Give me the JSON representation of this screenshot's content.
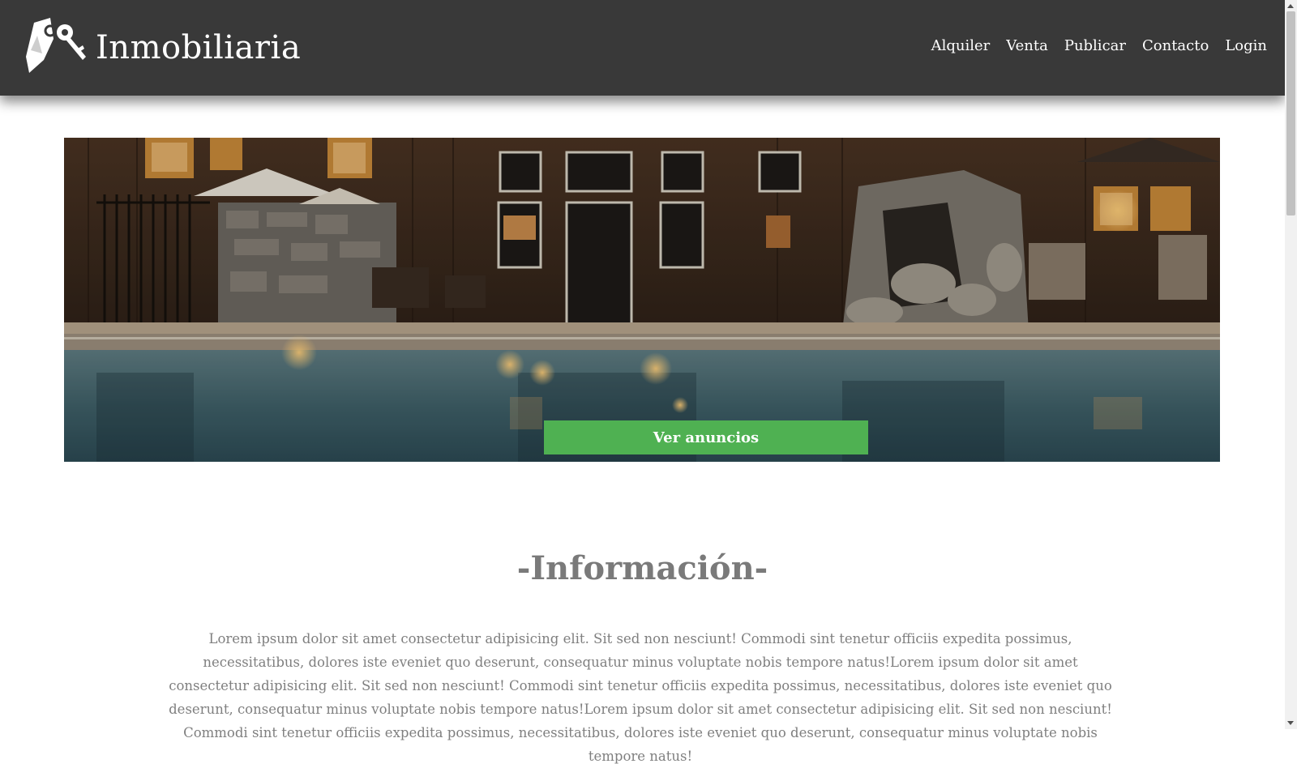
{
  "brand": {
    "name": "Inmobiliaria",
    "logo_icon": "house-keys-icon"
  },
  "nav": {
    "items": [
      {
        "label": "Alquiler"
      },
      {
        "label": "Venta"
      },
      {
        "label": "Publicar"
      },
      {
        "label": "Contacto"
      },
      {
        "label": "Login"
      }
    ]
  },
  "hero": {
    "image": "poolside-lodge-photo",
    "button_label": "Ver anuncios",
    "button_color": "#4fb152"
  },
  "info": {
    "title": "-Información-",
    "text": "Lorem ipsum dolor sit amet consectetur adipisicing elit. Sit sed non nesciunt! Commodi sint tenetur officiis expedita possimus, necessitatibus, dolores iste eveniet quo deserunt, consequatur minus voluptate nobis tempore natus!Lorem ipsum dolor sit amet consectetur adipisicing elit. Sit sed non nesciunt! Commodi sint tenetur officiis expedita possimus, necessitatibus, dolores iste eveniet quo deserunt, consequatur minus voluptate nobis tempore natus!Lorem ipsum dolor sit amet consectetur adipisicing elit. Sit sed non nesciunt! Commodi sint tenetur officiis expedita possimus, necessitatibus, dolores iste eveniet quo deserunt, consequatur minus voluptate nobis tempore natus!"
  },
  "colors": {
    "navbar": "#393939",
    "accent": "#4fb152",
    "text_muted": "#7f7f7f"
  }
}
